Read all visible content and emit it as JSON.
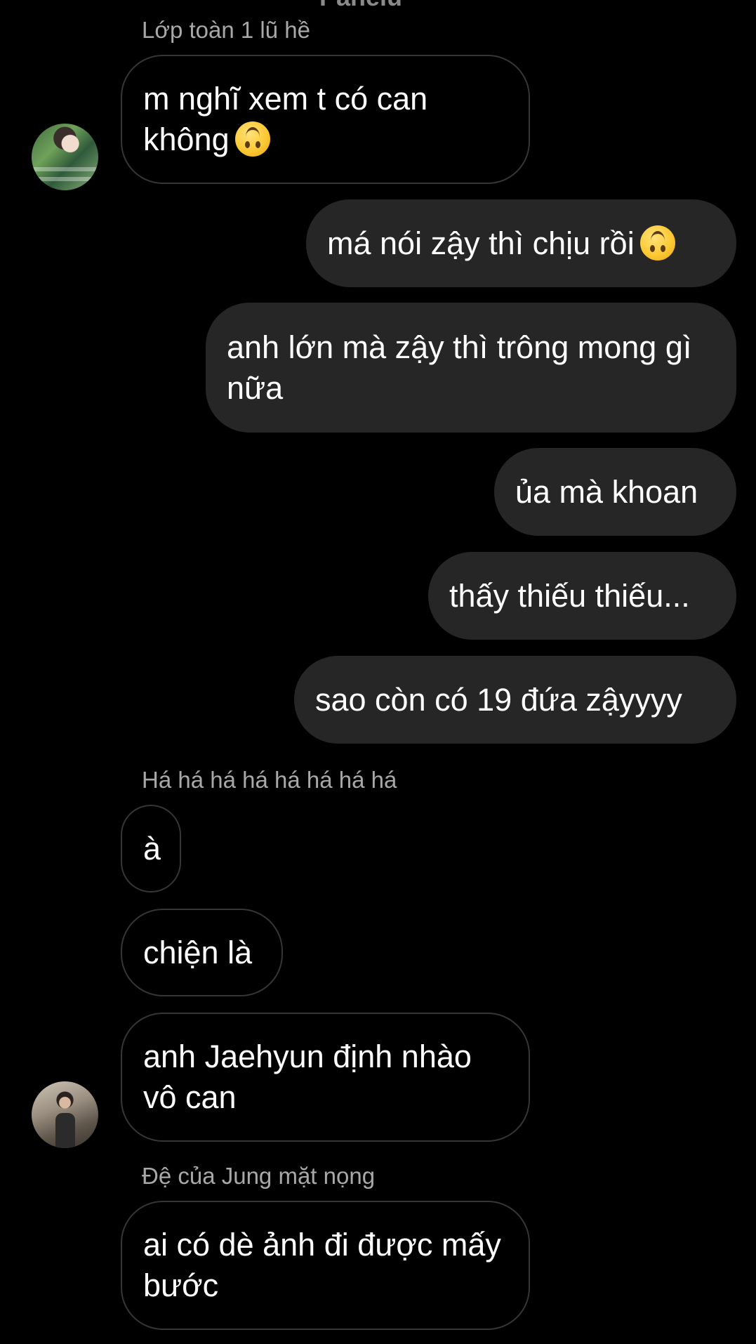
{
  "header_partial_text": "Panelu",
  "sender_names": {
    "first": "Lớp toàn 1 lũ hề",
    "second": "Há há há há há há há há",
    "third": "Đệ của Jung mặt nọng"
  },
  "messages": [
    {
      "side": "in",
      "text": "m nghĩ xem t có can không",
      "emoji": "upside-down-face"
    },
    {
      "side": "out",
      "text": "má nói zậy thì chịu rồi",
      "emoji": "upside-down-face"
    },
    {
      "side": "out",
      "text": "anh lớn mà zậy thì trông mong gì nữa"
    },
    {
      "side": "out",
      "text": "ủa mà khoan"
    },
    {
      "side": "out",
      "text": "thấy thiếu thiếu..."
    },
    {
      "side": "out",
      "text": "sao còn có 19 đứa zậyyyy"
    },
    {
      "side": "in",
      "text": "à"
    },
    {
      "side": "in",
      "text": "chiện là"
    },
    {
      "side": "in",
      "text": "anh Jaehyun định nhào vô can"
    },
    {
      "side": "in",
      "text": "ai có dè ảnh đi được mấy bước"
    }
  ],
  "avatars": [
    "avatar-sender-1",
    "avatar-sender-2"
  ],
  "colors": {
    "background": "#000000",
    "outgoing_bubble": "#262626",
    "incoming_border": "#363636",
    "sender_name": "#a8a8a8",
    "text": "#ffffff"
  }
}
